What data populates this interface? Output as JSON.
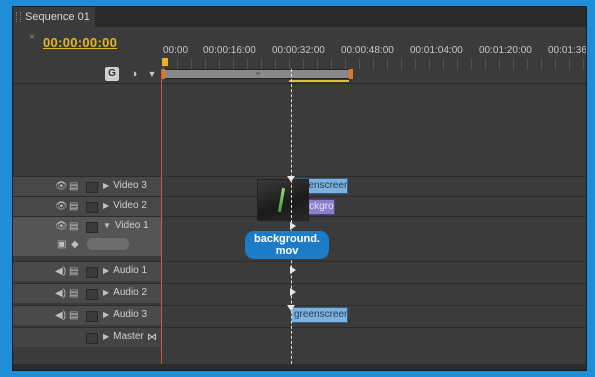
{
  "panel": {
    "tab_title": "Sequence 01",
    "tab_close": "×"
  },
  "timecode": "00:00:00:00",
  "ruler": {
    "labels": [
      "00:00",
      "00:00:16:00",
      "00:00:32:00",
      "00:00:48:00",
      "00:01:04:00",
      "00:01:20:00",
      "00:01:36"
    ]
  },
  "work_area_grip": "≡",
  "icons": {
    "snap": "snap-icon",
    "marker": "set-marker-icon",
    "keyframe": "keyframe-icon",
    "eye": "eye-icon",
    "speaker": "speaker-icon",
    "film": "film-icon",
    "master": "bowtie-icon"
  },
  "tracks": [
    {
      "name": "Video 3",
      "kind": "video",
      "expanded": false
    },
    {
      "name": "Video 2",
      "kind": "video",
      "expanded": false
    },
    {
      "name": "Video 1",
      "kind": "video",
      "expanded": true
    },
    {
      "name": "Audio 1",
      "kind": "audio",
      "expanded": false
    },
    {
      "name": "Audio 2",
      "kind": "audio",
      "expanded": false
    },
    {
      "name": "Audio 3",
      "kind": "audio",
      "expanded": false
    },
    {
      "name": "Master",
      "kind": "master",
      "expanded": false
    }
  ],
  "clips": {
    "video3": "greenscreen",
    "video2": "backgro",
    "audio3": "greenscreen"
  },
  "drag_tooltip": {
    "line1": "background.",
    "line2": "mov"
  },
  "colors": {
    "timecode": "#e8b422",
    "clip_blue": "#7fb1dc",
    "clip_lilac": "#8c7fc6",
    "tooltip": "#1d7cc8"
  }
}
